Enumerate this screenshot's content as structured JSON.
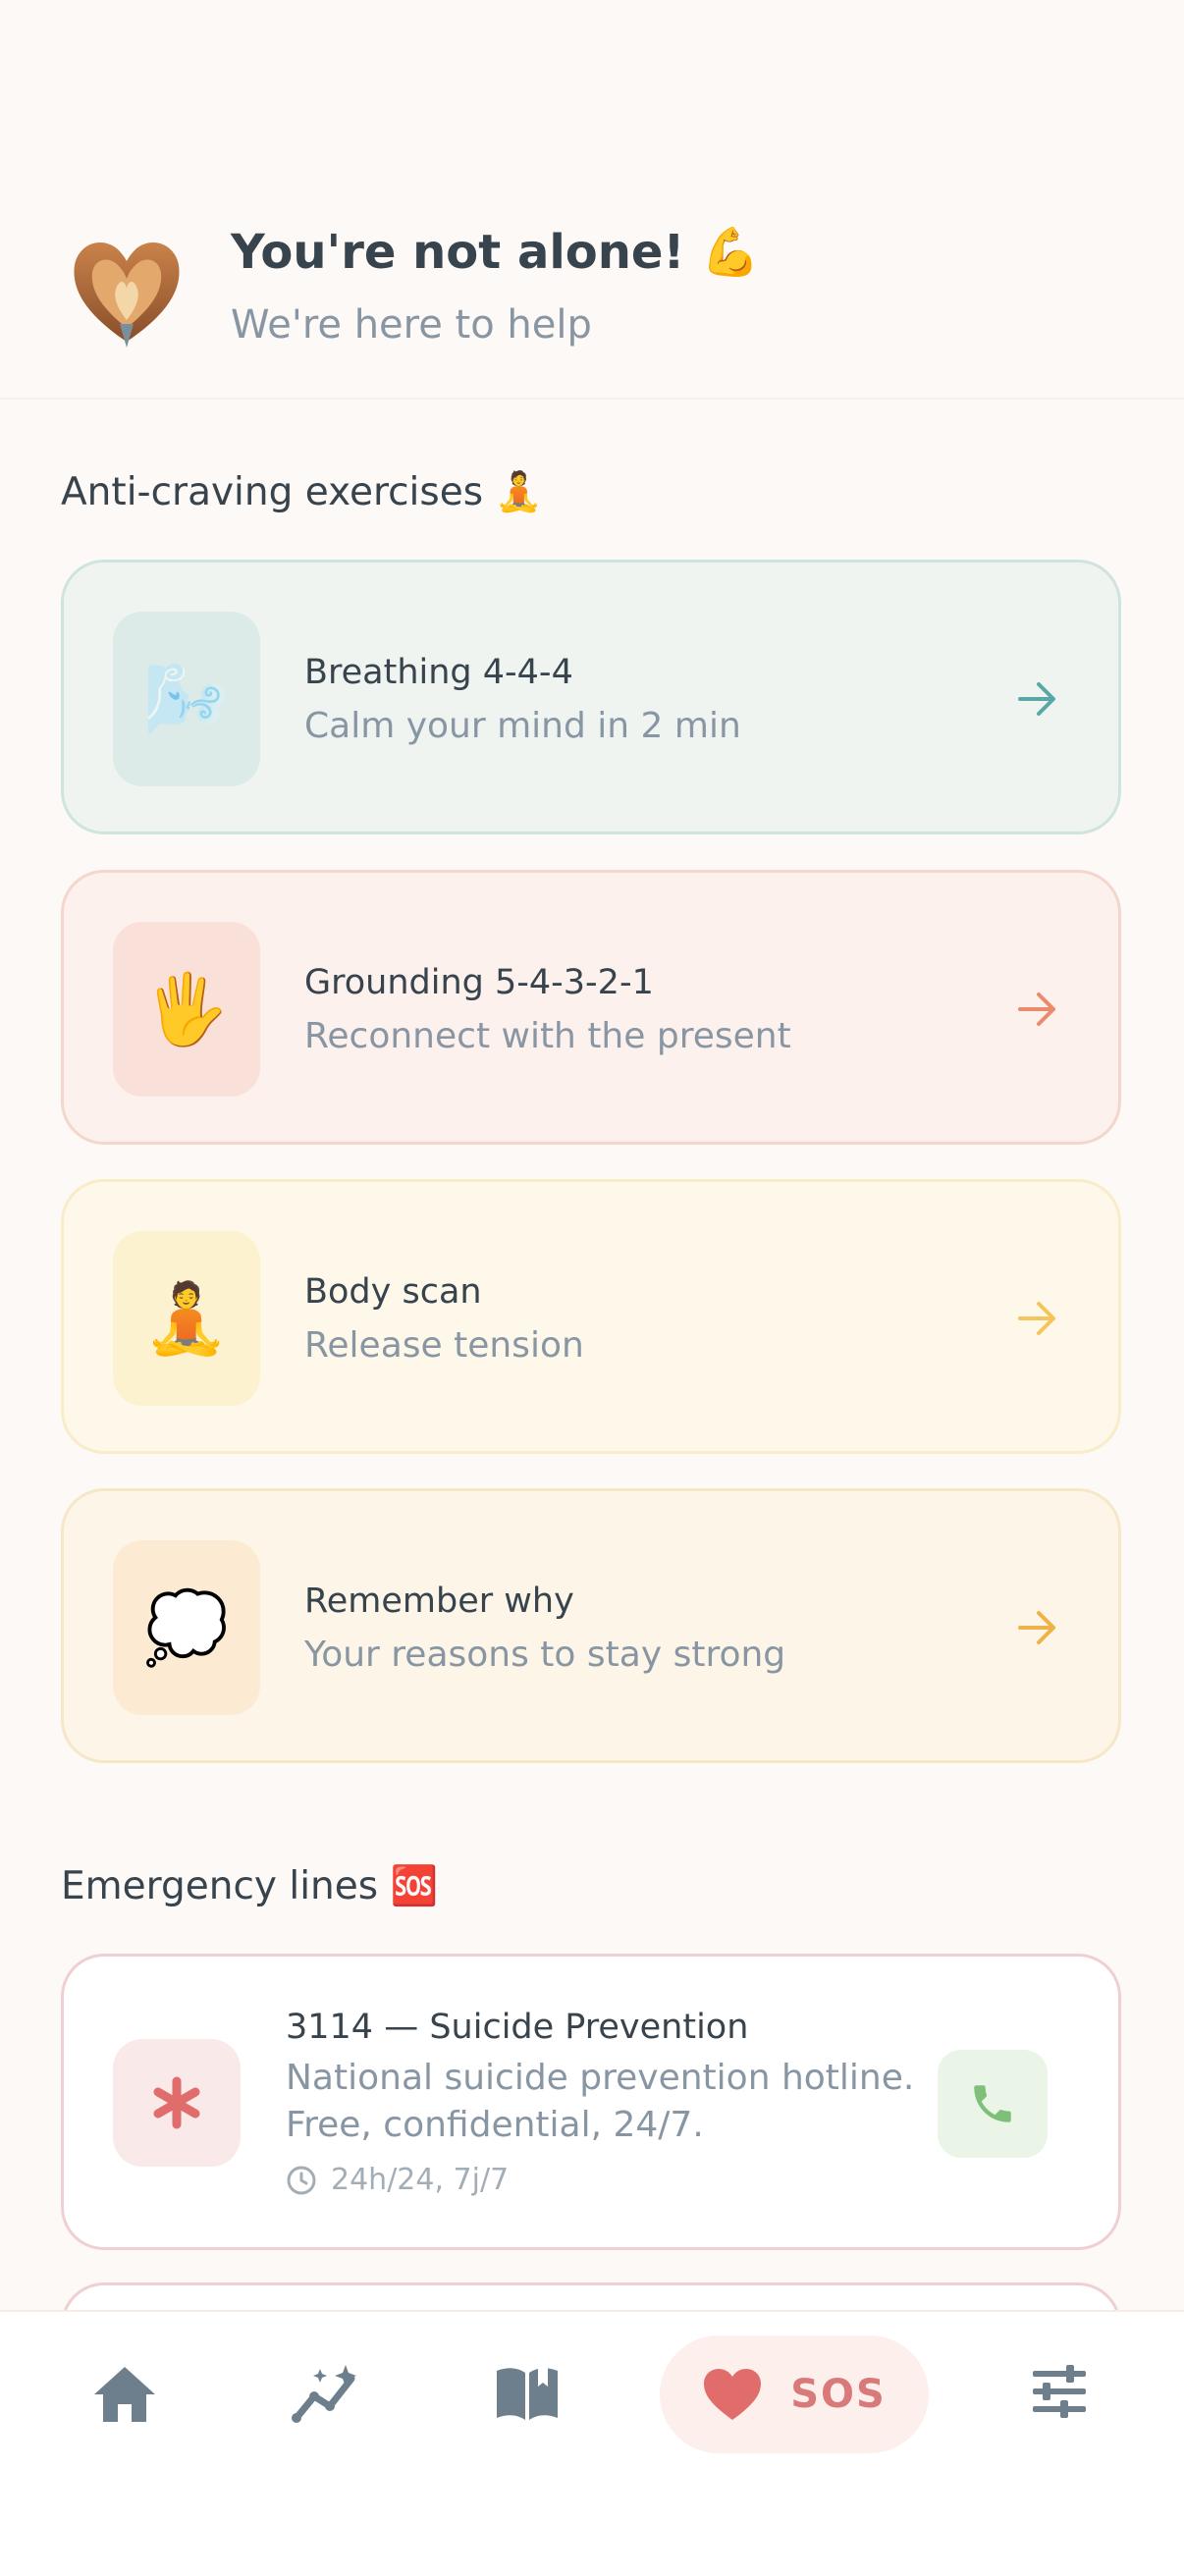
{
  "header": {
    "title": "You're not alone! 💪",
    "subtitle": "We're here to help"
  },
  "exercises_section": {
    "title": "Anti-craving exercises 🧘",
    "cards": [
      {
        "title": "Breathing 4-4-4",
        "subtitle": "Calm your mind in 2 min",
        "icon": "🌬️",
        "icon_name": "wind-face-icon",
        "accent": "#5aa8a5"
      },
      {
        "title": "Grounding 5-4-3-2-1",
        "subtitle": "Reconnect with the present",
        "icon": "🖐️",
        "icon_name": "hand-icon",
        "accent": "#ec8a6e"
      },
      {
        "title": "Body scan",
        "subtitle": "Release tension",
        "icon": "🧘",
        "icon_name": "meditation-icon",
        "accent": "#f3c55c"
      },
      {
        "title": "Remember why",
        "subtitle": "Your reasons to stay strong",
        "icon": "💭",
        "icon_name": "thought-bubble-icon",
        "accent": "#f0b148"
      }
    ]
  },
  "emergency_section": {
    "title": "Emergency lines 🆘",
    "lines": [
      {
        "title": "3114 — Suicide Prevention",
        "description": "National suicide prevention hotline. Free, confidential, 24/7.",
        "hours": "24h/24, 7j/7"
      }
    ]
  },
  "nav": {
    "items": [
      "home-icon",
      "stats-icon",
      "journal-icon",
      "sos-heart-icon",
      "settings-sliders-icon"
    ],
    "sos_label": "SOS"
  }
}
